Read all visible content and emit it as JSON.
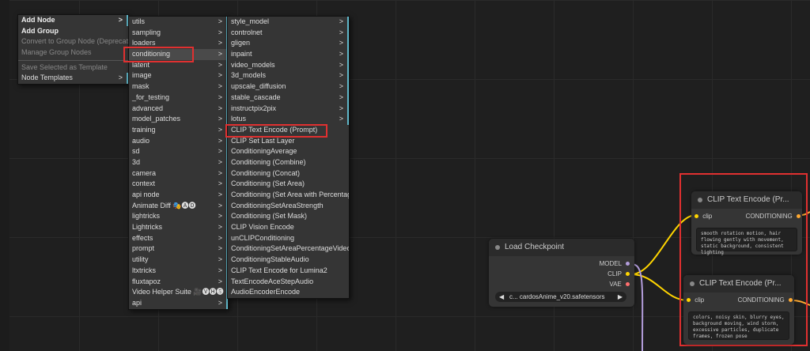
{
  "canvas_menu": {
    "items": [
      {
        "label": "Add Node",
        "style": "bold",
        "has_sub": true
      },
      {
        "label": "Add Group",
        "style": "bold",
        "has_sub": false
      },
      {
        "label": "Convert to Group Node (Deprecated)",
        "style": "disabled",
        "has_sub": false
      },
      {
        "label": "Manage Group Nodes",
        "style": "disabled",
        "has_sub": false
      },
      {
        "label": "Save Selected as Template",
        "style": "disabled",
        "has_sub": false
      },
      {
        "label": "Node Templates",
        "style": "normal",
        "has_sub": true
      }
    ]
  },
  "category_menu": {
    "items": [
      "utils",
      "sampling",
      "loaders",
      "conditioning",
      "latent",
      "image",
      "mask",
      "_for_testing",
      "advanced",
      "model_patches",
      "training",
      "audio",
      "sd",
      "3d",
      "camera",
      "context",
      "api node",
      "Animate Diff 🎭🅐🅓",
      "lightricks",
      "Lightricks",
      "effects",
      "prompt",
      "utility",
      "ltxtricks",
      "fluxtapoz",
      "Video Helper Suite 🎥🅥🅗🅢",
      "api"
    ],
    "selected": "conditioning"
  },
  "conditioning_menu": {
    "submenus": [
      "style_model",
      "controlnet",
      "gligen",
      "inpaint",
      "video_models",
      "3d_models",
      "upscale_diffusion",
      "stable_cascade",
      "instructpix2pix",
      "lotus"
    ],
    "nodes": [
      "CLIP Text Encode (Prompt)",
      "CLIP Set Last Layer",
      "ConditioningAverage",
      "Conditioning (Combine)",
      "Conditioning (Concat)",
      "Conditioning (Set Area)",
      "Conditioning (Set Area with Percentage)",
      "ConditioningSetAreaStrength",
      "Conditioning (Set Mask)",
      "CLIP Vision Encode",
      "unCLIPConditioning",
      "ConditioningSetAreaPercentageVideo",
      "ConditioningStableAudio",
      "CLIP Text Encode for Lumina2",
      "TextEncodeAceStepAudio",
      "AudioEncoderEncode"
    ],
    "highlighted": "CLIP Text Encode (Prompt)"
  },
  "nodes": {
    "load_checkpoint": {
      "title": "Load Checkpoint",
      "outputs": [
        "MODEL",
        "CLIP",
        "VAE"
      ],
      "widget_value": "c... cardosAnime_v20.safetensors"
    },
    "clip_positive": {
      "title": "CLIP Text Encode (Pr...",
      "input": "clip",
      "output": "CONDITIONING",
      "text": "smooth rotation motion, hair flowing gently with movement, static background, consistent lighting"
    },
    "clip_negative": {
      "title": "CLIP Text Encode (Pr...",
      "input": "clip",
      "output": "CONDITIONING",
      "text": "colors, noisy skin, blurry eyes, background moving, wind storm, excessive particles, duplicate frames, frozen pose"
    }
  },
  "colors": {
    "highlight": "#e03030",
    "submenu_accent": "#5fb7c9",
    "model_slot": "#b39ddb",
    "clip_slot": "#ffd500",
    "vae_slot": "#ff6e6e",
    "conditioning_slot": "#ffa931"
  }
}
